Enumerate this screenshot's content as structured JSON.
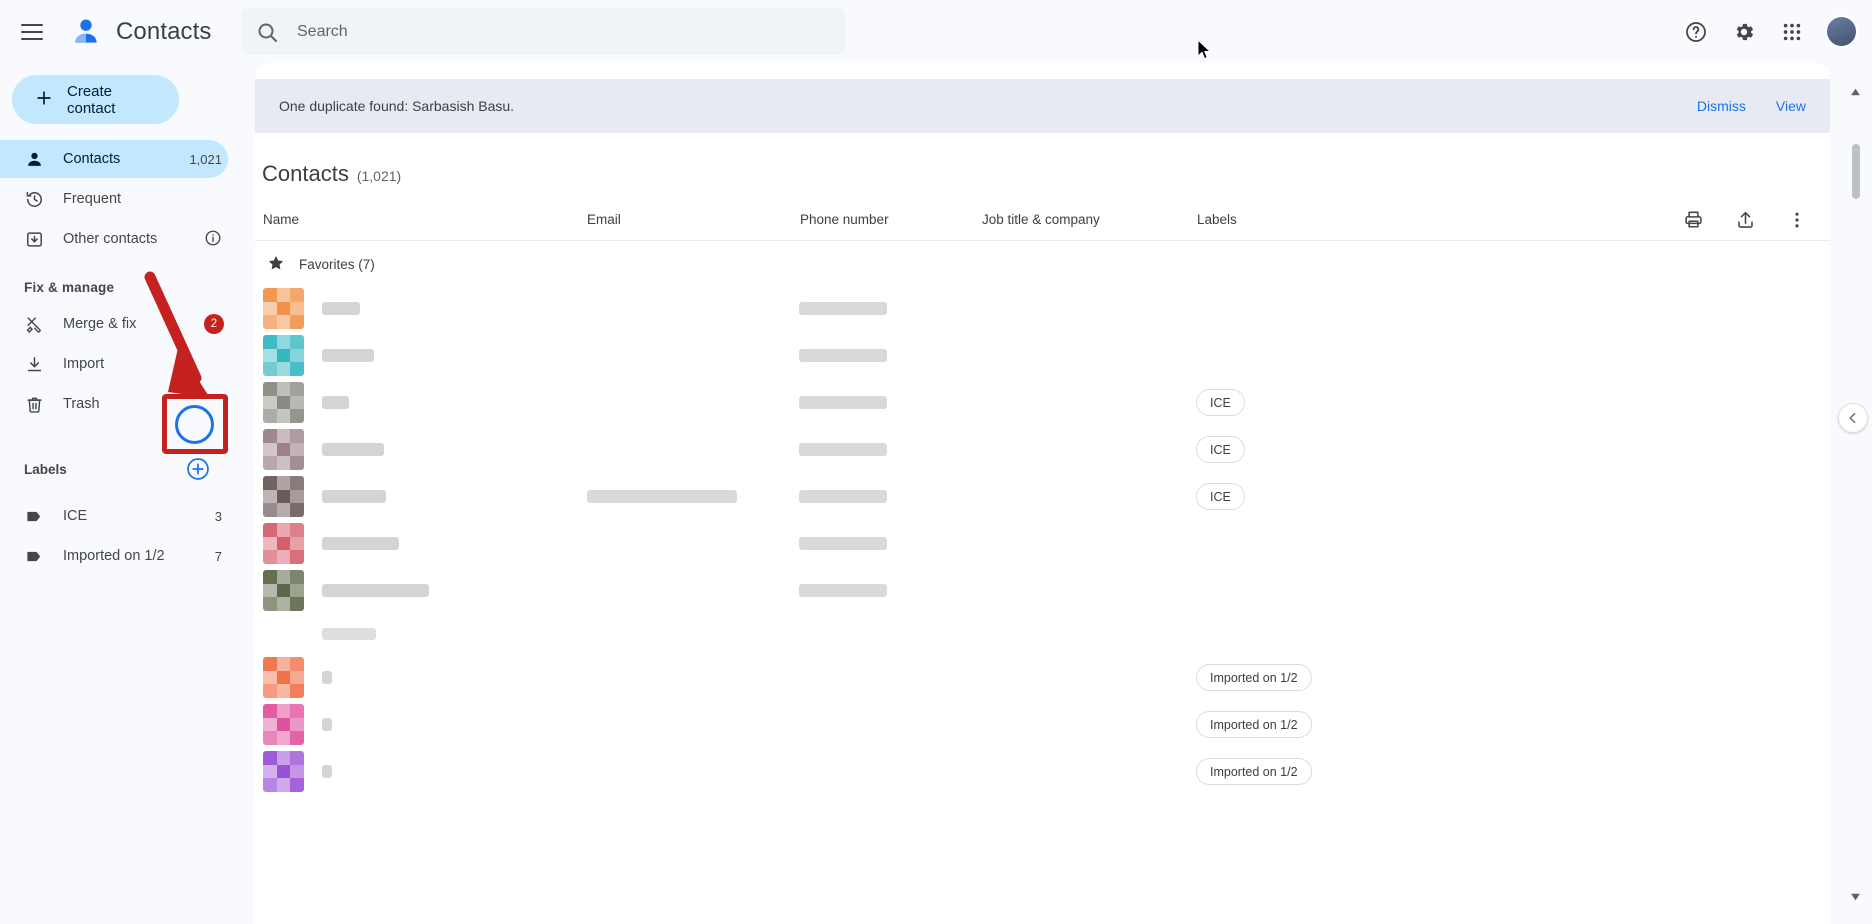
{
  "topbar": {
    "menu_icon": "hamburger-icon",
    "app_title": "Contacts",
    "logo_icon": "contacts-logo-icon",
    "search": {
      "placeholder": "Search",
      "value": "",
      "icon": "search-icon"
    },
    "help_icon": "help-icon",
    "settings_icon": "gear-icon",
    "apps_icon": "apps-grid-icon",
    "avatar_name": "account-avatar"
  },
  "sidebar": {
    "create_button": {
      "label": "Create contact",
      "icon": "plus-icon"
    },
    "nav": [
      {
        "label": "Contacts",
        "count": "1,021",
        "icon": "person-icon",
        "active": true
      },
      {
        "label": "Frequent",
        "count": "",
        "icon": "history-icon",
        "active": false
      },
      {
        "label": "Other contacts",
        "count": "",
        "icon": "archive-down-icon",
        "active": false,
        "info_icon": "info-icon"
      }
    ],
    "fix_section_title": "Fix & manage",
    "fix_items": [
      {
        "label": "Merge & fix",
        "icon": "merge-tools-icon",
        "badge": "2"
      },
      {
        "label": "Import",
        "icon": "download-icon",
        "badge": ""
      },
      {
        "label": "Trash",
        "icon": "trash-icon",
        "badge": ""
      }
    ],
    "labels_title": "Labels",
    "create_label_icon": "plus-circle-icon",
    "labels": [
      {
        "label": "ICE",
        "count": "3",
        "icon": "label-tag-icon"
      },
      {
        "label": "Imported on 1/2",
        "count": "7",
        "icon": "label-tag-icon"
      }
    ]
  },
  "banner": {
    "message": "One duplicate found: Sarbasish Basu.",
    "dismiss_label": "Dismiss",
    "view_label": "View"
  },
  "main": {
    "title": "Contacts",
    "count": "(1,021)",
    "columns": [
      "Name",
      "Email",
      "Phone number",
      "Job title & company",
      "Labels"
    ],
    "actions": [
      {
        "name": "print-icon"
      },
      {
        "name": "export-icon"
      },
      {
        "name": "more-options-icon"
      }
    ],
    "group": {
      "label": "Favorites (7)",
      "icon": "star-icon"
    },
    "rows": [
      {
        "avatar": "#f19248",
        "name_w": 38,
        "email_w": 0,
        "phone_w": 88,
        "chip": ""
      },
      {
        "avatar": "#35b7c2",
        "name_w": 52,
        "email_w": 0,
        "phone_w": 88,
        "chip": ""
      },
      {
        "avatar": "#8a8a82",
        "name_w": 27,
        "email_w": 0,
        "phone_w": 88,
        "chip": "ICE"
      },
      {
        "avatar": "#9b8189",
        "name_w": 62,
        "email_w": 0,
        "phone_w": 88,
        "chip": "ICE"
      },
      {
        "avatar": "#6c5a5a",
        "name_w": 64,
        "email_w": 150,
        "phone_w": 88,
        "chip": "ICE"
      },
      {
        "avatar": "#d4606e",
        "name_w": 77,
        "email_w": 0,
        "phone_w": 88,
        "chip": ""
      },
      {
        "avatar": "#5d6648",
        "name_w": 107,
        "email_w": 0,
        "phone_w": 88,
        "chip": ""
      },
      {
        "avatar": "",
        "name_w": 0,
        "email_w": 0,
        "phone_w": 0,
        "chip": "",
        "spacer": true
      },
      {
        "avatar": "#f0714a",
        "name_w": 10,
        "email_w": 0,
        "phone_w": 0,
        "chip": "Imported on 1/2"
      },
      {
        "avatar": "#e0529e",
        "name_w": 10,
        "email_w": 0,
        "phone_w": 0,
        "chip": "Imported on 1/2"
      },
      {
        "avatar": "#9b51d6",
        "name_w": 10,
        "email_w": 0,
        "phone_w": 0,
        "chip": "Imported on 1/2"
      }
    ],
    "panel_toggle_icon": "chevron-left-icon",
    "scroll_up_icon": "scroll-up-arrow",
    "scroll_down_icon": "scroll-down-arrow"
  },
  "annotation": {
    "arrow_color": "#c5221f",
    "highlight_color": "#c5221f",
    "ring_color": "#1a73e8",
    "target": "create-label-button"
  }
}
